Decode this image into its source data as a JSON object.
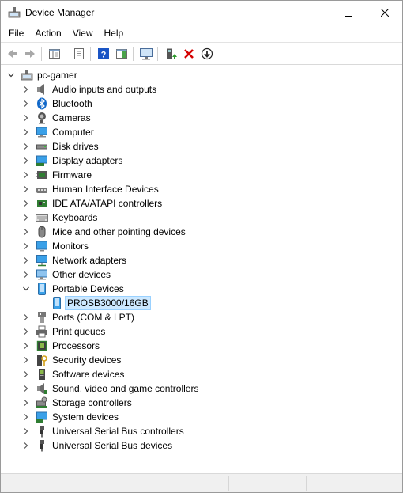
{
  "window": {
    "title": "Device Manager",
    "controls": [
      "minimize",
      "maximize",
      "close"
    ]
  },
  "menu": [
    "File",
    "Action",
    "View",
    "Help"
  ],
  "toolbar": {
    "buttons": [
      "back-icon",
      "forward-icon",
      "show-hide-console-tree-icon",
      "properties-icon",
      "help-icon",
      "action-pane-icon",
      "scan-hardware-icon",
      "update-driver-icon",
      "uninstall-device-icon",
      "disable-device-icon"
    ]
  },
  "tree": {
    "root": "pc-gamer",
    "categories": [
      {
        "label": "Audio inputs and outputs",
        "icon": "speaker-icon",
        "expanded": false
      },
      {
        "label": "Bluetooth",
        "icon": "bluetooth-icon",
        "expanded": false
      },
      {
        "label": "Cameras",
        "icon": "camera-icon",
        "expanded": false
      },
      {
        "label": "Computer",
        "icon": "computer-icon",
        "expanded": false
      },
      {
        "label": "Disk drives",
        "icon": "disk-drive-icon",
        "expanded": false
      },
      {
        "label": "Display adapters",
        "icon": "display-adapter-icon",
        "expanded": false
      },
      {
        "label": "Firmware",
        "icon": "firmware-icon",
        "expanded": false
      },
      {
        "label": "Human Interface Devices",
        "icon": "hid-icon",
        "expanded": false
      },
      {
        "label": "IDE ATA/ATAPI controllers",
        "icon": "ide-controller-icon",
        "expanded": false
      },
      {
        "label": "Keyboards",
        "icon": "keyboard-icon",
        "expanded": false
      },
      {
        "label": "Mice and other pointing devices",
        "icon": "mouse-icon",
        "expanded": false
      },
      {
        "label": "Monitors",
        "icon": "monitor-icon",
        "expanded": false
      },
      {
        "label": "Network adapters",
        "icon": "network-adapter-icon",
        "expanded": false
      },
      {
        "label": "Other devices",
        "icon": "other-devices-icon",
        "expanded": false
      },
      {
        "label": "Portable Devices",
        "icon": "portable-device-icon",
        "expanded": true,
        "children": [
          {
            "label": "PROSB3000/16GB",
            "icon": "portable-device-icon",
            "selected": true
          }
        ]
      },
      {
        "label": "Ports (COM & LPT)",
        "icon": "port-icon",
        "expanded": false
      },
      {
        "label": "Print queues",
        "icon": "printer-icon",
        "expanded": false
      },
      {
        "label": "Processors",
        "icon": "processor-icon",
        "expanded": false
      },
      {
        "label": "Security devices",
        "icon": "security-key-icon",
        "expanded": false
      },
      {
        "label": "Software devices",
        "icon": "software-device-icon",
        "expanded": false
      },
      {
        "label": "Sound, video and game controllers",
        "icon": "sound-controller-icon",
        "expanded": false
      },
      {
        "label": "Storage controllers",
        "icon": "storage-controller-icon",
        "expanded": false
      },
      {
        "label": "System devices",
        "icon": "system-devices-icon",
        "expanded": false
      },
      {
        "label": "Universal Serial Bus controllers",
        "icon": "usb-icon",
        "expanded": false
      },
      {
        "label": "Universal Serial Bus devices",
        "icon": "usb-icon",
        "expanded": false
      }
    ]
  },
  "colors": {
    "selection_bg": "#cce8ff",
    "selection_border": "#99d1ff",
    "uninstall_red": "#d40000",
    "help_blue": "#1b55c5"
  }
}
